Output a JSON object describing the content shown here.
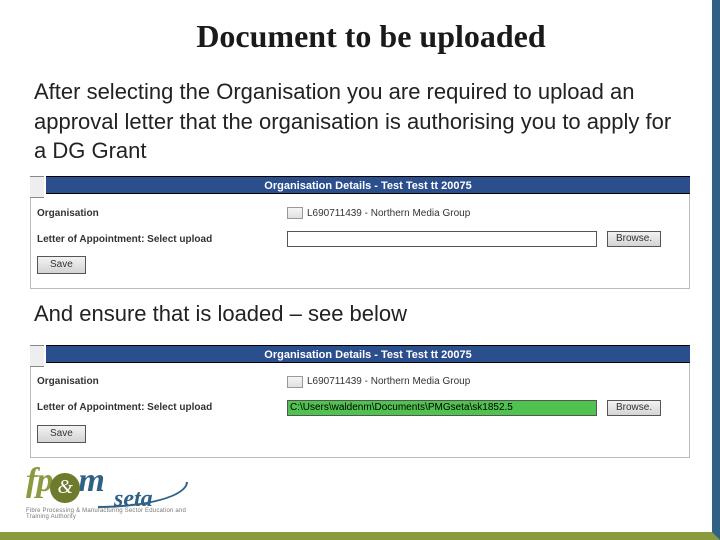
{
  "title": "Document to be uploaded",
  "para1": "After selecting the Organisation you are required to upload an approval letter that the organisation is authorising you to apply for a DG Grant",
  "para2": "And ensure that is loaded – see below",
  "bar_title": "Organisation Details - Test Test tt 20075",
  "labels": {
    "org": "Organisation",
    "letter": "Letter of Appointment: Select upload"
  },
  "org_value": "L690711439 - Northern Media Group",
  "file_value_empty": "",
  "file_value_filled": "C:\\Users\\waldenm\\Documents\\PMGseta\\sk1852.5",
  "buttons": {
    "browse": "Browse.",
    "save": "Save"
  },
  "logo": {
    "fp": "fp",
    "amp": "&",
    "m": "m",
    "seta": "seta",
    "tag": "Fibre Processing & Manufacturing Sector Education and Training Authority"
  }
}
